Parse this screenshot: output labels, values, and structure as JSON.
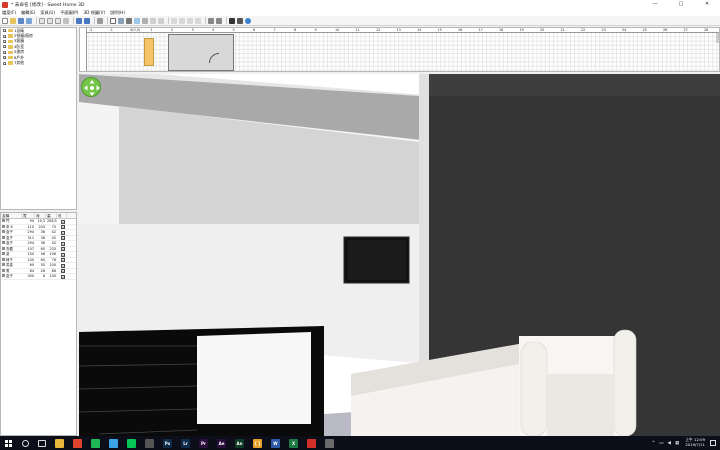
{
  "window": {
    "title": "* 未命名 [修改] - Sweet Home 3D",
    "controls": [
      "—",
      "□",
      "✕"
    ]
  },
  "menu": [
    "檔案(F)",
    "編輯(E)",
    "家具(U)",
    "平面圖(P)",
    "3D 視圖(V)",
    "說明(H)"
  ],
  "catalog": {
    "items": [
      "1浴衛",
      "2餐廳/廚房",
      "3客廳",
      "4臥室",
      "5書房",
      "6戶外",
      "7其他"
    ]
  },
  "furniture_table": {
    "headers": [
      "名稱",
      "寬",
      "深",
      "高",
      "可"
    ],
    "rows": [
      {
        "name": "門",
        "w": "90",
        "d": "19,3",
        "h": "208,5",
        "v": "☑"
      },
      {
        "name": "床 6",
        "w": "110",
        "d": "203",
        "h": "70",
        "v": "☑"
      },
      {
        "name": "盒子",
        "w": "294",
        "d": "36",
        "h": "42",
        "v": "☑"
      },
      {
        "name": "盒子",
        "w": "311",
        "d": "36",
        "h": "42",
        "v": "☑"
      },
      {
        "name": "盒子",
        "w": "294",
        "d": "36",
        "h": "42",
        "v": "☑"
      },
      {
        "name": "衣櫃",
        "w": "107",
        "d": "60",
        "h": "233",
        "v": "☑"
      },
      {
        "name": "桌",
        "w": "150",
        "d": "46",
        "h": "106",
        "v": "☑"
      },
      {
        "name": "椅子",
        "w": "140",
        "d": "60",
        "h": "78",
        "v": "☑"
      },
      {
        "name": "書桌",
        "w": "60",
        "d": "55",
        "h": "100",
        "v": "☑"
      },
      {
        "name": "電",
        "w": "84",
        "d": "26",
        "h": "86",
        "v": "☑"
      },
      {
        "name": "盒子",
        "w": "300",
        "d": "6",
        "h": "150",
        "v": "☑"
      }
    ]
  },
  "plan": {
    "ruler_labels": [
      "-2",
      "-1",
      "0(0,0)",
      "1",
      "2",
      "3",
      "4",
      "5",
      "6",
      "7",
      "8",
      "9",
      "10",
      "11",
      "12",
      "13",
      "14",
      "15",
      "16",
      "17",
      "18",
      "19",
      "20",
      "21",
      "22",
      "23",
      "24",
      "25",
      "26",
      "27",
      "28"
    ]
  },
  "taskbar": {
    "apps": [
      {
        "icon": "file-explorer-icon",
        "color": "#e8b73c",
        "label": ""
      },
      {
        "icon": "chrome-icon",
        "color": "#e0442f",
        "label": ""
      },
      {
        "icon": "spotify-icon",
        "color": "#1db954",
        "label": ""
      },
      {
        "icon": "app-icon",
        "color": "#39a4e8",
        "label": ""
      },
      {
        "icon": "line-icon",
        "color": "#07c755",
        "label": ""
      },
      {
        "icon": "unity-icon",
        "color": "#555555",
        "label": ""
      },
      {
        "icon": "photoshop-icon",
        "color": "#0d2c4a",
        "label": "Ps"
      },
      {
        "icon": "lightroom-icon",
        "color": "#0d2c4a",
        "label": "Lr"
      },
      {
        "icon": "premiere-icon",
        "color": "#2a0f3c",
        "label": "Pr"
      },
      {
        "icon": "after-effects-icon",
        "color": "#2a0f3c",
        "label": "Ae"
      },
      {
        "icon": "animate-icon",
        "color": "#0f3a26",
        "label": "An"
      },
      {
        "icon": "brackets-icon",
        "color": "#e8a32c",
        "label": "[ ]"
      },
      {
        "icon": "word-icon",
        "color": "#2c5aa8",
        "label": "W"
      },
      {
        "icon": "excel-icon",
        "color": "#1d7a45",
        "label": "X"
      },
      {
        "icon": "acrobat-icon",
        "color": "#d4302a",
        "label": ""
      },
      {
        "icon": "sweet-home-3d-icon",
        "color": "#6b6b6b",
        "label": ""
      }
    ],
    "clock_time": "上午 12:09",
    "clock_date": "2019/7/11"
  }
}
